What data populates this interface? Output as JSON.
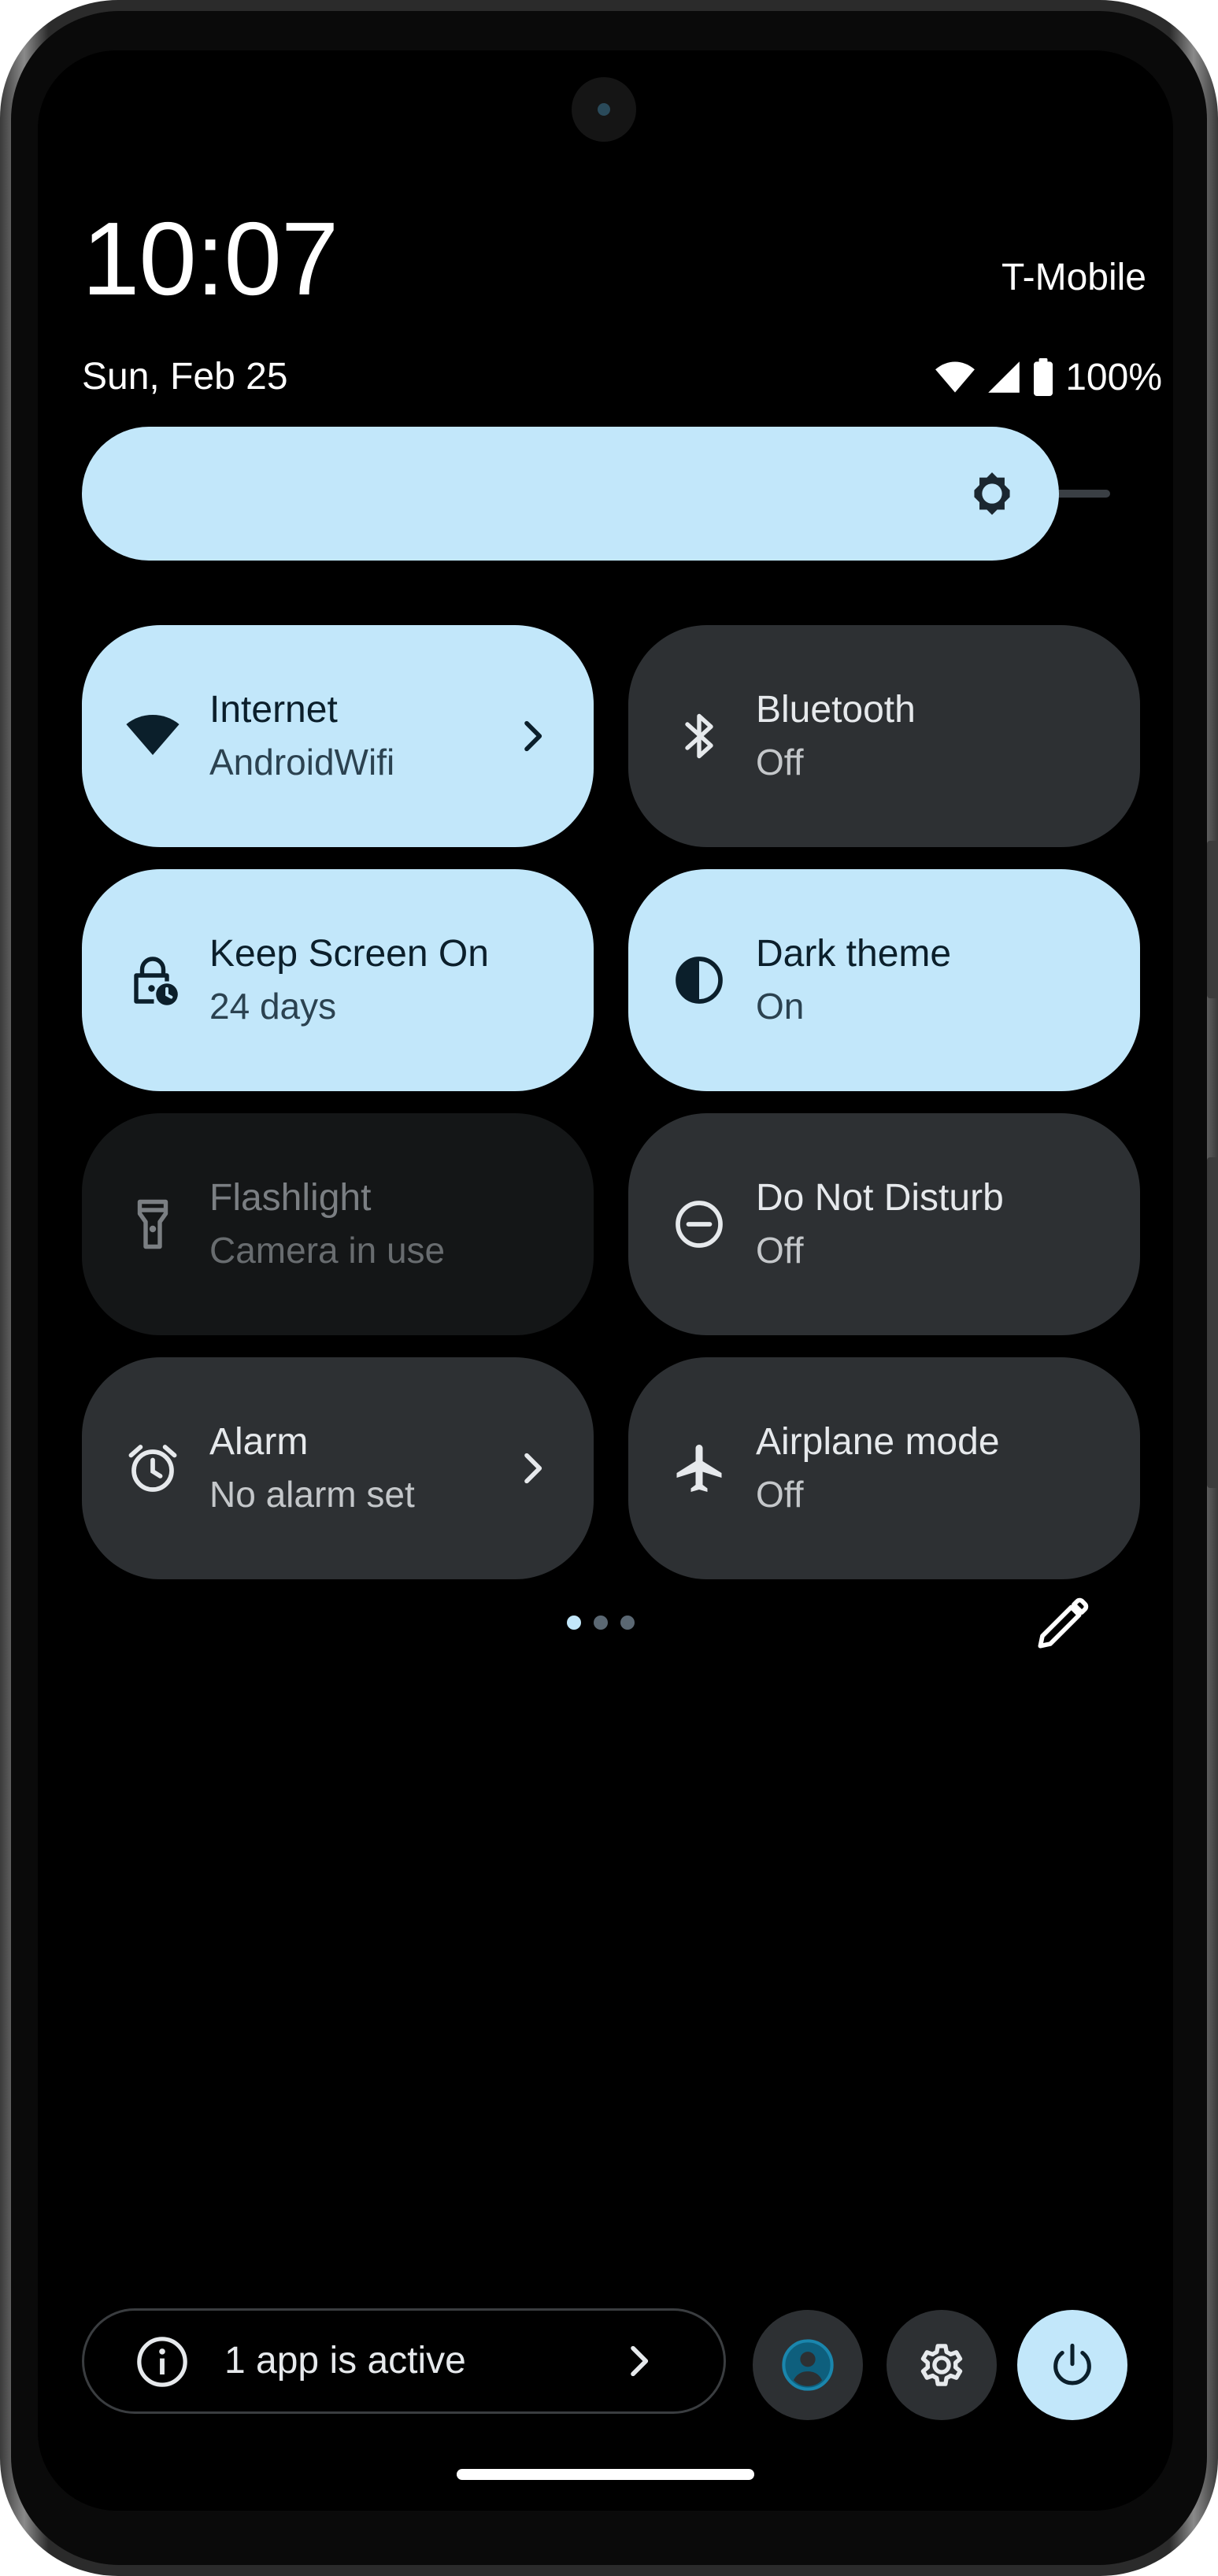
{
  "status_bar": {
    "time": "10:07",
    "date": "Sun, Feb 25",
    "carrier": "T-Mobile",
    "battery": "100%",
    "icons": [
      "wifi-icon",
      "cellular-signal-icon",
      "battery-icon"
    ]
  },
  "brightness": {
    "level": 0.95,
    "icon": "brightness-icon"
  },
  "tiles": [
    {
      "title": "Internet",
      "subtitle": "AndroidWifi",
      "state": "on",
      "icon": "wifi-icon",
      "has_chevron": true
    },
    {
      "title": "Bluetooth",
      "subtitle": "Off",
      "state": "off",
      "icon": "bluetooth-icon",
      "has_chevron": false
    },
    {
      "title": "Keep Screen On",
      "subtitle": "24 days",
      "state": "on",
      "icon": "lock-timer-icon",
      "has_chevron": false
    },
    {
      "title": "Dark theme",
      "subtitle": "On",
      "state": "on",
      "icon": "contrast-icon",
      "has_chevron": false
    },
    {
      "title": "Flashlight",
      "subtitle": "Camera in use",
      "state": "disabled",
      "icon": "flashlight-icon",
      "has_chevron": false
    },
    {
      "title": "Do Not Disturb",
      "subtitle": "Off",
      "state": "off",
      "icon": "do-not-disturb-icon",
      "has_chevron": false
    },
    {
      "title": "Alarm",
      "subtitle": "No alarm set",
      "state": "off",
      "icon": "alarm-icon",
      "has_chevron": true
    },
    {
      "title": "Airplane mode",
      "subtitle": "Off",
      "state": "off",
      "icon": "airplane-icon",
      "has_chevron": false
    }
  ],
  "pager": {
    "pages": 3,
    "current": 1
  },
  "footer": {
    "active_apps_label": "1 app is active",
    "buttons": [
      "user-switcher-icon",
      "settings-icon",
      "power-icon"
    ]
  },
  "colors": {
    "tile_on": "#c2e7fa",
    "tile_off": "#2d3033",
    "tile_disabled": "#141617",
    "background": "#000000"
  }
}
